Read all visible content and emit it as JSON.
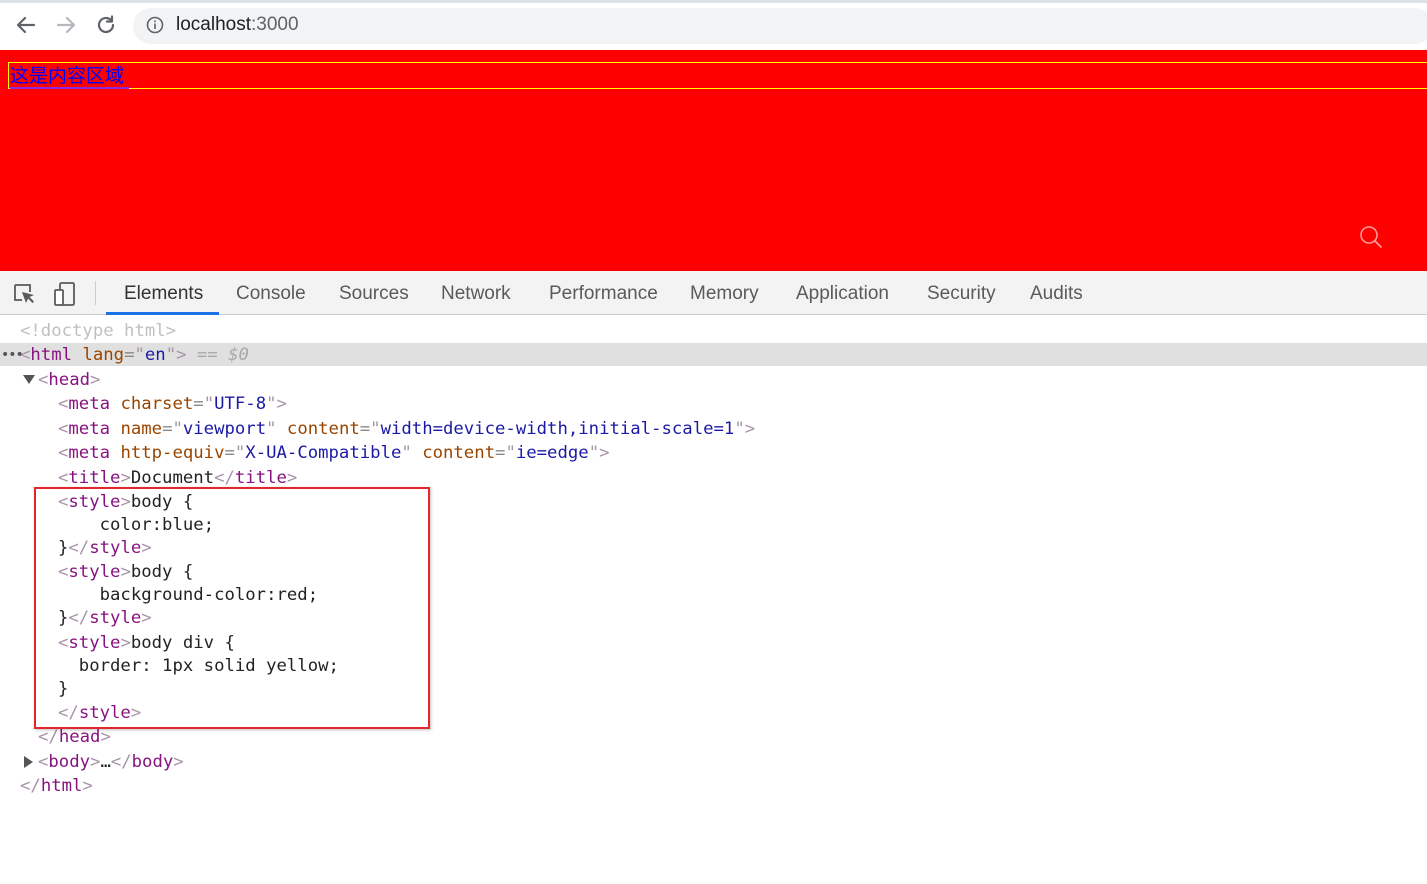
{
  "browser": {
    "url_host": "localhost",
    "url_port": ":3000",
    "icons": {
      "back": "arrow-left-icon",
      "forward": "arrow-right-icon",
      "reload": "reload-icon",
      "info": "info-circle-icon"
    }
  },
  "page": {
    "content_text": "这是内容区域",
    "background_color": "#ff0000",
    "text_color": "#0000ff",
    "border_color": "#ffff00"
  },
  "devtools": {
    "tabs": [
      "Elements",
      "Console",
      "Sources",
      "Network",
      "Performance",
      "Memory",
      "Application",
      "Security",
      "Audits"
    ],
    "active_tab": "Elements",
    "tools": {
      "inspect": "inspect-element-icon",
      "device": "device-toolbar-icon"
    },
    "dom": {
      "doctype": "<!doctype html>",
      "html_open": {
        "tag": "html",
        "attr": "lang",
        "value": "en",
        "suffix": "== $0"
      },
      "head_tag": "head",
      "meta_charset": {
        "attr": "charset",
        "value": "UTF-8"
      },
      "meta_viewport": {
        "attr1": "name",
        "value1": "viewport",
        "attr2": "content",
        "value2": "width=device-width,initial-scale=1"
      },
      "meta_compat": {
        "attr1": "http-equiv",
        "value1": "X-UA-Compatible",
        "attr2": "content",
        "value2": "ie=edge"
      },
      "title_text": "Document",
      "style1": {
        "line1": "body {",
        "line2": "    color:blue;",
        "line3": "}"
      },
      "style2": {
        "line1": "body {",
        "line2": "    background-color:red;",
        "line3": "}"
      },
      "style3": {
        "line1": "body div {",
        "line2": "  border: 1px solid yellow;",
        "line3": "}"
      },
      "body_ellipsis": "…",
      "tag_meta": "meta",
      "tag_title": "title",
      "tag_style": "style",
      "tag_body": "body"
    },
    "highlight_color": "#e3262b"
  }
}
